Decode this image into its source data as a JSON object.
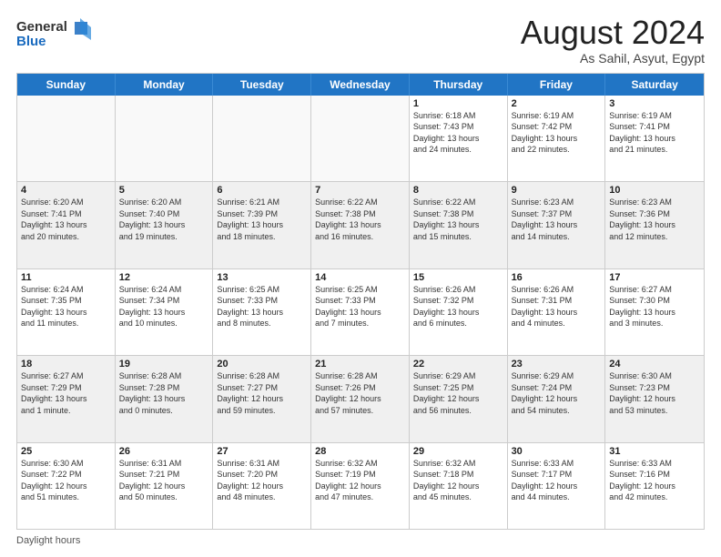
{
  "header": {
    "logo": {
      "line1": "General",
      "line2": "Blue"
    },
    "title": "August 2024",
    "subtitle": "As Sahil, Asyut, Egypt"
  },
  "calendar": {
    "days_of_week": [
      "Sunday",
      "Monday",
      "Tuesday",
      "Wednesday",
      "Thursday",
      "Friday",
      "Saturday"
    ],
    "weeks": [
      [
        {
          "day": "",
          "info": "",
          "empty": true
        },
        {
          "day": "",
          "info": "",
          "empty": true
        },
        {
          "day": "",
          "info": "",
          "empty": true
        },
        {
          "day": "",
          "info": "",
          "empty": true
        },
        {
          "day": "1",
          "info": "Sunrise: 6:18 AM\nSunset: 7:43 PM\nDaylight: 13 hours\nand 24 minutes.",
          "empty": false
        },
        {
          "day": "2",
          "info": "Sunrise: 6:19 AM\nSunset: 7:42 PM\nDaylight: 13 hours\nand 22 minutes.",
          "empty": false
        },
        {
          "day": "3",
          "info": "Sunrise: 6:19 AM\nSunset: 7:41 PM\nDaylight: 13 hours\nand 21 minutes.",
          "empty": false
        }
      ],
      [
        {
          "day": "4",
          "info": "Sunrise: 6:20 AM\nSunset: 7:41 PM\nDaylight: 13 hours\nand 20 minutes.",
          "empty": false,
          "shaded": true
        },
        {
          "day": "5",
          "info": "Sunrise: 6:20 AM\nSunset: 7:40 PM\nDaylight: 13 hours\nand 19 minutes.",
          "empty": false,
          "shaded": true
        },
        {
          "day": "6",
          "info": "Sunrise: 6:21 AM\nSunset: 7:39 PM\nDaylight: 13 hours\nand 18 minutes.",
          "empty": false,
          "shaded": true
        },
        {
          "day": "7",
          "info": "Sunrise: 6:22 AM\nSunset: 7:38 PM\nDaylight: 13 hours\nand 16 minutes.",
          "empty": false,
          "shaded": true
        },
        {
          "day": "8",
          "info": "Sunrise: 6:22 AM\nSunset: 7:38 PM\nDaylight: 13 hours\nand 15 minutes.",
          "empty": false,
          "shaded": true
        },
        {
          "day": "9",
          "info": "Sunrise: 6:23 AM\nSunset: 7:37 PM\nDaylight: 13 hours\nand 14 minutes.",
          "empty": false,
          "shaded": true
        },
        {
          "day": "10",
          "info": "Sunrise: 6:23 AM\nSunset: 7:36 PM\nDaylight: 13 hours\nand 12 minutes.",
          "empty": false,
          "shaded": true
        }
      ],
      [
        {
          "day": "11",
          "info": "Sunrise: 6:24 AM\nSunset: 7:35 PM\nDaylight: 13 hours\nand 11 minutes.",
          "empty": false
        },
        {
          "day": "12",
          "info": "Sunrise: 6:24 AM\nSunset: 7:34 PM\nDaylight: 13 hours\nand 10 minutes.",
          "empty": false
        },
        {
          "day": "13",
          "info": "Sunrise: 6:25 AM\nSunset: 7:33 PM\nDaylight: 13 hours\nand 8 minutes.",
          "empty": false
        },
        {
          "day": "14",
          "info": "Sunrise: 6:25 AM\nSunset: 7:33 PM\nDaylight: 13 hours\nand 7 minutes.",
          "empty": false
        },
        {
          "day": "15",
          "info": "Sunrise: 6:26 AM\nSunset: 7:32 PM\nDaylight: 13 hours\nand 6 minutes.",
          "empty": false
        },
        {
          "day": "16",
          "info": "Sunrise: 6:26 AM\nSunset: 7:31 PM\nDaylight: 13 hours\nand 4 minutes.",
          "empty": false
        },
        {
          "day": "17",
          "info": "Sunrise: 6:27 AM\nSunset: 7:30 PM\nDaylight: 13 hours\nand 3 minutes.",
          "empty": false
        }
      ],
      [
        {
          "day": "18",
          "info": "Sunrise: 6:27 AM\nSunset: 7:29 PM\nDaylight: 13 hours\nand 1 minute.",
          "empty": false,
          "shaded": true
        },
        {
          "day": "19",
          "info": "Sunrise: 6:28 AM\nSunset: 7:28 PM\nDaylight: 13 hours\nand 0 minutes.",
          "empty": false,
          "shaded": true
        },
        {
          "day": "20",
          "info": "Sunrise: 6:28 AM\nSunset: 7:27 PM\nDaylight: 12 hours\nand 59 minutes.",
          "empty": false,
          "shaded": true
        },
        {
          "day": "21",
          "info": "Sunrise: 6:28 AM\nSunset: 7:26 PM\nDaylight: 12 hours\nand 57 minutes.",
          "empty": false,
          "shaded": true
        },
        {
          "day": "22",
          "info": "Sunrise: 6:29 AM\nSunset: 7:25 PM\nDaylight: 12 hours\nand 56 minutes.",
          "empty": false,
          "shaded": true
        },
        {
          "day": "23",
          "info": "Sunrise: 6:29 AM\nSunset: 7:24 PM\nDaylight: 12 hours\nand 54 minutes.",
          "empty": false,
          "shaded": true
        },
        {
          "day": "24",
          "info": "Sunrise: 6:30 AM\nSunset: 7:23 PM\nDaylight: 12 hours\nand 53 minutes.",
          "empty": false,
          "shaded": true
        }
      ],
      [
        {
          "day": "25",
          "info": "Sunrise: 6:30 AM\nSunset: 7:22 PM\nDaylight: 12 hours\nand 51 minutes.",
          "empty": false
        },
        {
          "day": "26",
          "info": "Sunrise: 6:31 AM\nSunset: 7:21 PM\nDaylight: 12 hours\nand 50 minutes.",
          "empty": false
        },
        {
          "day": "27",
          "info": "Sunrise: 6:31 AM\nSunset: 7:20 PM\nDaylight: 12 hours\nand 48 minutes.",
          "empty": false
        },
        {
          "day": "28",
          "info": "Sunrise: 6:32 AM\nSunset: 7:19 PM\nDaylight: 12 hours\nand 47 minutes.",
          "empty": false
        },
        {
          "day": "29",
          "info": "Sunrise: 6:32 AM\nSunset: 7:18 PM\nDaylight: 12 hours\nand 45 minutes.",
          "empty": false
        },
        {
          "day": "30",
          "info": "Sunrise: 6:33 AM\nSunset: 7:17 PM\nDaylight: 12 hours\nand 44 minutes.",
          "empty": false
        },
        {
          "day": "31",
          "info": "Sunrise: 6:33 AM\nSunset: 7:16 PM\nDaylight: 12 hours\nand 42 minutes.",
          "empty": false
        }
      ]
    ]
  },
  "footer": {
    "text": "Daylight hours"
  }
}
